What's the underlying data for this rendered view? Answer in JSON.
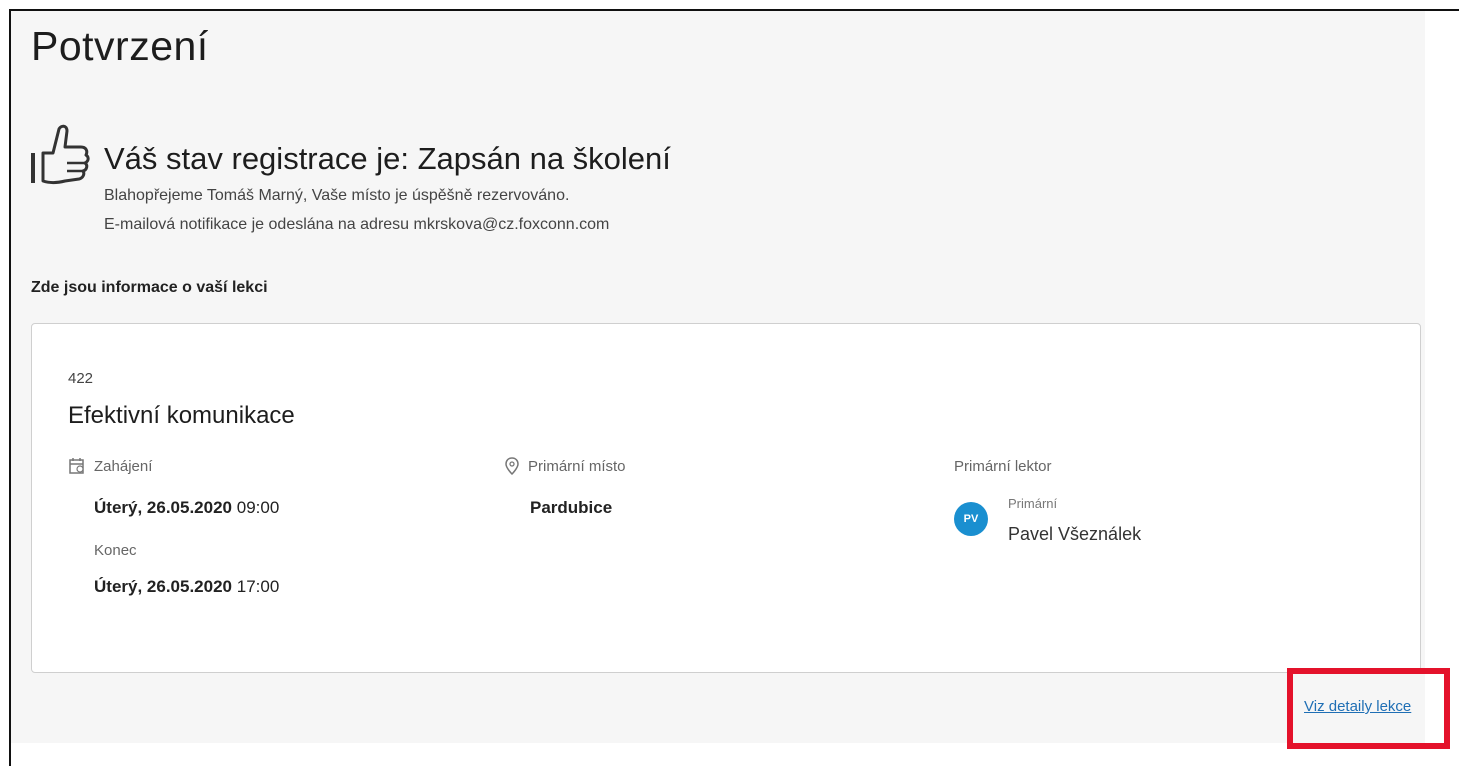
{
  "page": {
    "title": "Potvrzení"
  },
  "status": {
    "icon": "thumbs-up-icon",
    "heading": "Váš stav registrace je: Zapsán na školení",
    "line1": "Blahopřejeme Tomáš Marný, Vaše místo je úspěšně rezervováno.",
    "line2": "E-mailová notifikace je odeslána na adresu mkrskova@cz.foxconn.com"
  },
  "section": {
    "label": "Zde jsou informace o vaší lekci"
  },
  "lesson": {
    "code": "422",
    "title": "Efektivní komunikace",
    "start": {
      "icon": "calendar-icon",
      "label": "Zahájení",
      "date": "Úterý, 26.05.2020",
      "time": "09:00"
    },
    "end": {
      "label": "Konec",
      "date": "Úterý, 26.05.2020",
      "time": "17:00"
    },
    "place": {
      "icon": "location-pin-icon",
      "label": "Primární místo",
      "value": "Pardubice"
    },
    "lector": {
      "label": "Primární lektor",
      "initials": "PV",
      "role": "Primární",
      "name": "Pavel Všeználek",
      "avatar_color": "#1a8fd0"
    }
  },
  "actions": {
    "detail_link": "Viz detaily lekce",
    "highlight_color": "#e4122b",
    "link_color": "#1f6fb5"
  }
}
